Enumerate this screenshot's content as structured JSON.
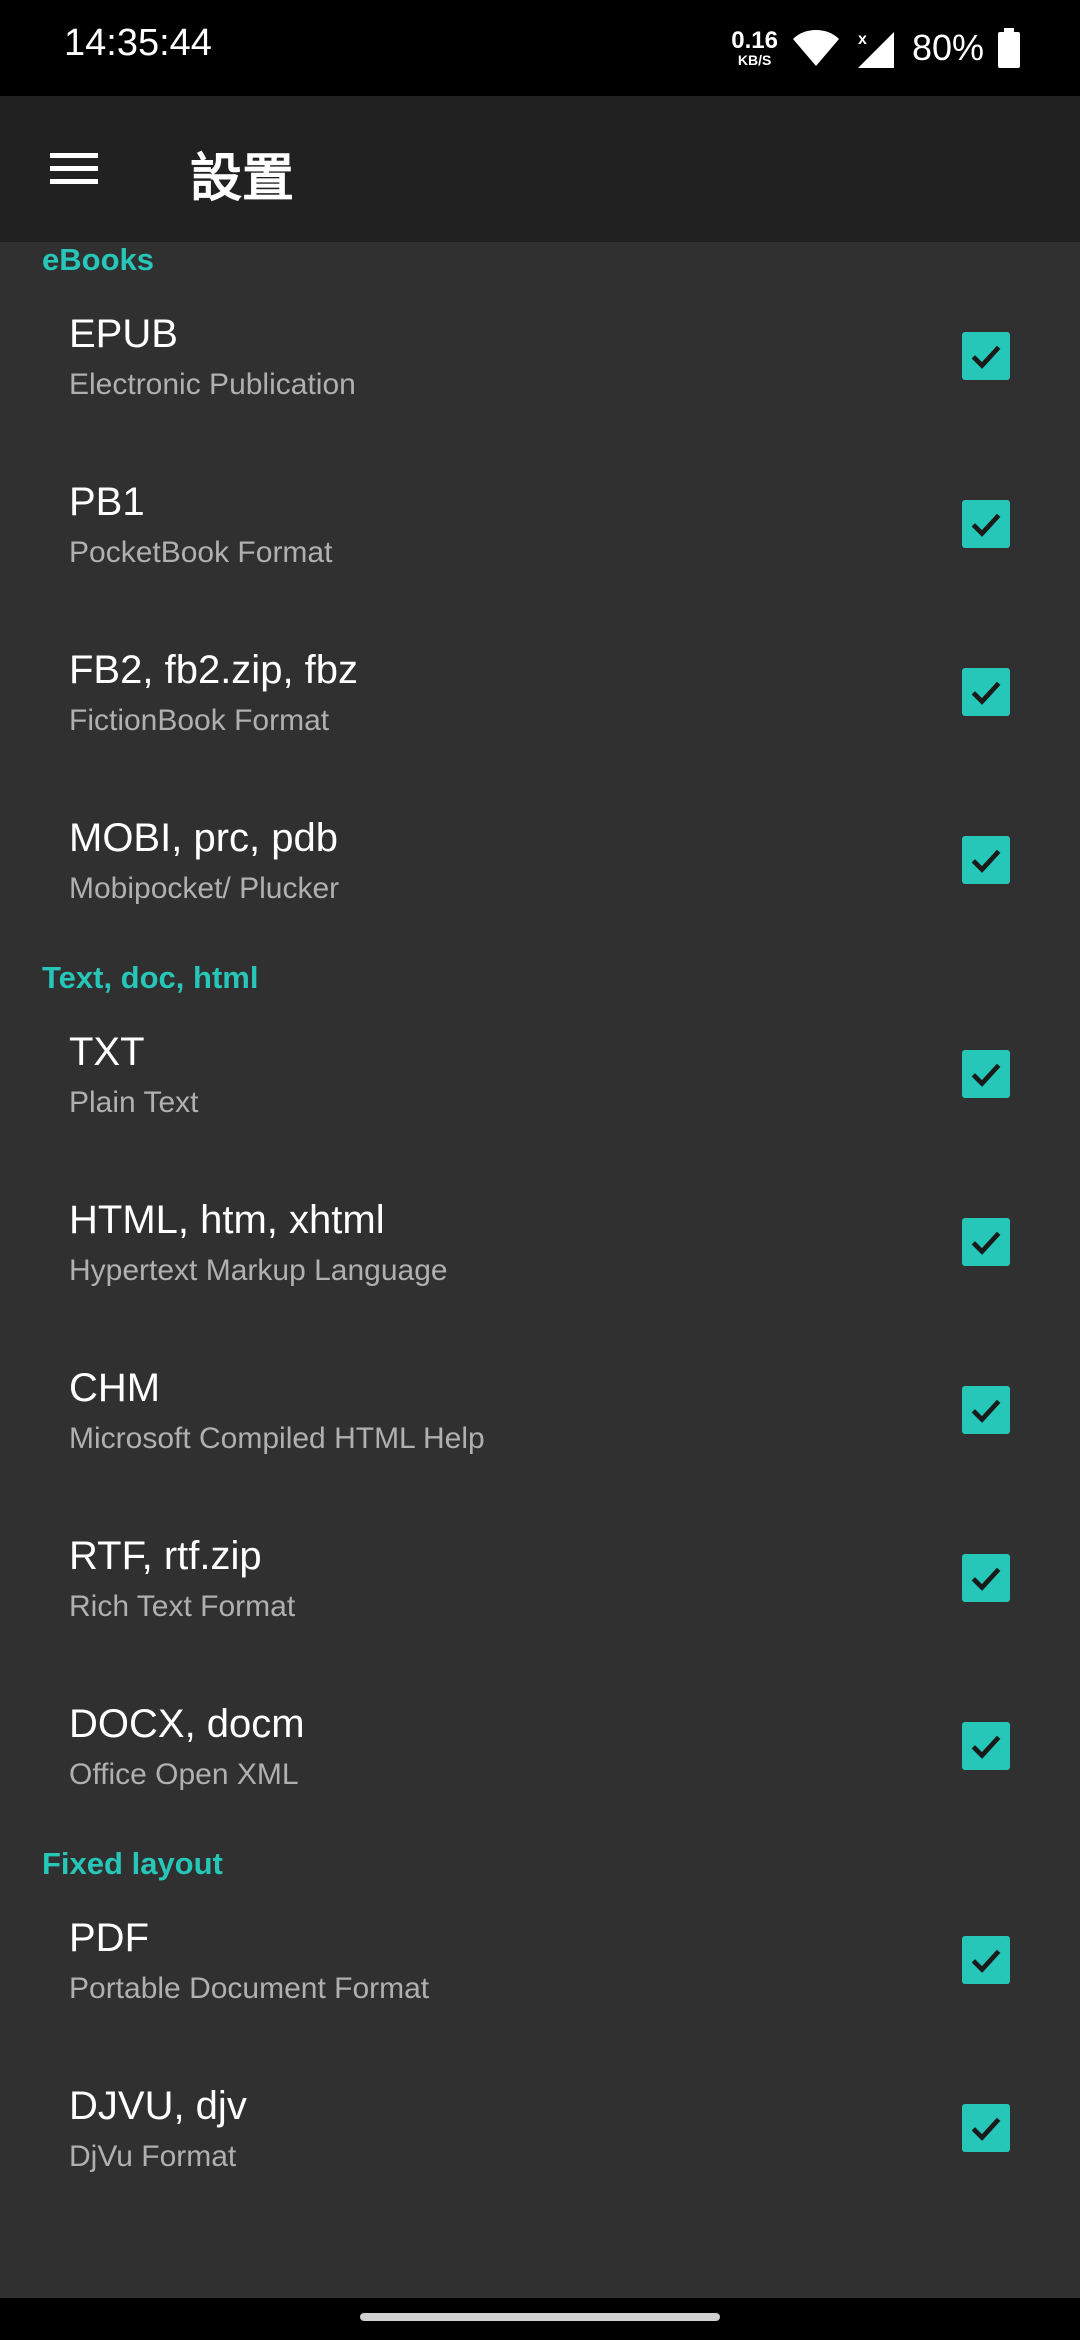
{
  "status_bar": {
    "time": "14:35:44",
    "net_speed_value": "0.16",
    "net_speed_unit": "KB/S",
    "battery": "80%",
    "icons": [
      "wifi-icon",
      "cell-signal-icon",
      "battery-icon"
    ]
  },
  "app_bar": {
    "title": "設置",
    "menu_icon": "hamburger-menu-icon"
  },
  "colors": {
    "accent": "#26c6b8",
    "background": "#303030",
    "app_bar": "#212121"
  },
  "sections": [
    {
      "header": "eBooks",
      "items": [
        {
          "title": "EPUB",
          "subtitle": "Electronic Publication",
          "checked": true
        },
        {
          "title": "PB1",
          "subtitle": "PocketBook Format",
          "checked": true
        },
        {
          "title": "FB2, fb2.zip, fbz",
          "subtitle": "FictionBook Format",
          "checked": true
        },
        {
          "title": "MOBI, prc, pdb",
          "subtitle": "Mobipocket/ Plucker",
          "checked": true
        }
      ]
    },
    {
      "header": "Text, doc, html",
      "items": [
        {
          "title": "TXT",
          "subtitle": "Plain Text",
          "checked": true
        },
        {
          "title": "HTML, htm, xhtml",
          "subtitle": "Hypertext Markup Language",
          "checked": true
        },
        {
          "title": "CHM",
          "subtitle": "Microsoft Compiled HTML Help",
          "checked": true
        },
        {
          "title": "RTF, rtf.zip",
          "subtitle": "Rich Text Format",
          "checked": true
        },
        {
          "title": "DOCX, docm",
          "subtitle": "Office Open XML",
          "checked": true
        }
      ]
    },
    {
      "header": "Fixed layout",
      "items": [
        {
          "title": "PDF",
          "subtitle": "Portable Document Format",
          "checked": true
        },
        {
          "title": "DJVU, djv",
          "subtitle": "DjVu Format",
          "checked": true
        }
      ]
    }
  ]
}
